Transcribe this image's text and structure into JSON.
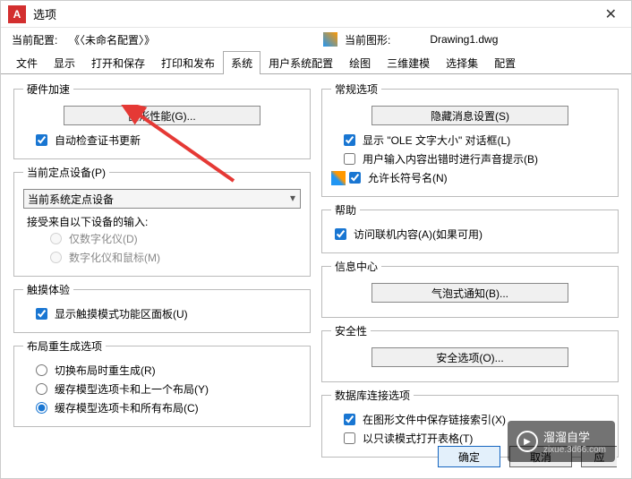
{
  "window": {
    "title": "选项"
  },
  "profile": {
    "current_label": "当前配置:",
    "current_value": "《〈未命名配置〉》",
    "drawing_label": "当前图形:",
    "drawing_value": "Drawing1.dwg"
  },
  "tabs": [
    "文件",
    "显示",
    "打开和保存",
    "打印和发布",
    "系统",
    "用户系统配置",
    "绘图",
    "三维建模",
    "选择集",
    "配置"
  ],
  "active_tab": "系统",
  "left": {
    "hw_accel": {
      "legend": "硬件加速",
      "btn": "图形性能(G)...",
      "chk_cert": "自动检查证书更新"
    },
    "pointing": {
      "legend": "当前定点设备(P)",
      "select_value": "当前系统定点设备",
      "accept_label": "接受来自以下设备的输入:",
      "r1": "仅数字化仪(D)",
      "r2": "数字化仪和鼠标(M)"
    },
    "touch": {
      "legend": "触摸体验",
      "chk": "显示触摸模式功能区面板(U)"
    },
    "layout": {
      "legend": "布局重生成选项",
      "r1": "切换布局时重生成(R)",
      "r2": "缓存模型选项卡和上一个布局(Y)",
      "r3": "缓存模型选项卡和所有布局(C)"
    }
  },
  "right": {
    "general": {
      "legend": "常规选项",
      "btn": "隐藏消息设置(S)",
      "c1": "显示 \"OLE 文字大小\" 对话框(L)",
      "c2": "用户输入内容出错时进行声音提示(B)",
      "c3": "允许长符号名(N)"
    },
    "help": {
      "legend": "帮助",
      "c1": "访问联机内容(A)(如果可用)"
    },
    "info": {
      "legend": "信息中心",
      "btn": "气泡式通知(B)..."
    },
    "security": {
      "legend": "安全性",
      "btn": "安全选项(O)..."
    },
    "db": {
      "legend": "数据库连接选项",
      "c1": "在图形文件中保存链接索引(X)",
      "c2": "以只读模式打开表格(T)"
    }
  },
  "buttons": {
    "ok": "确定",
    "cancel": "取消",
    "apply": "应"
  },
  "watermark": {
    "brand": "溜溜自学",
    "url": "zixue.3d66.com"
  }
}
